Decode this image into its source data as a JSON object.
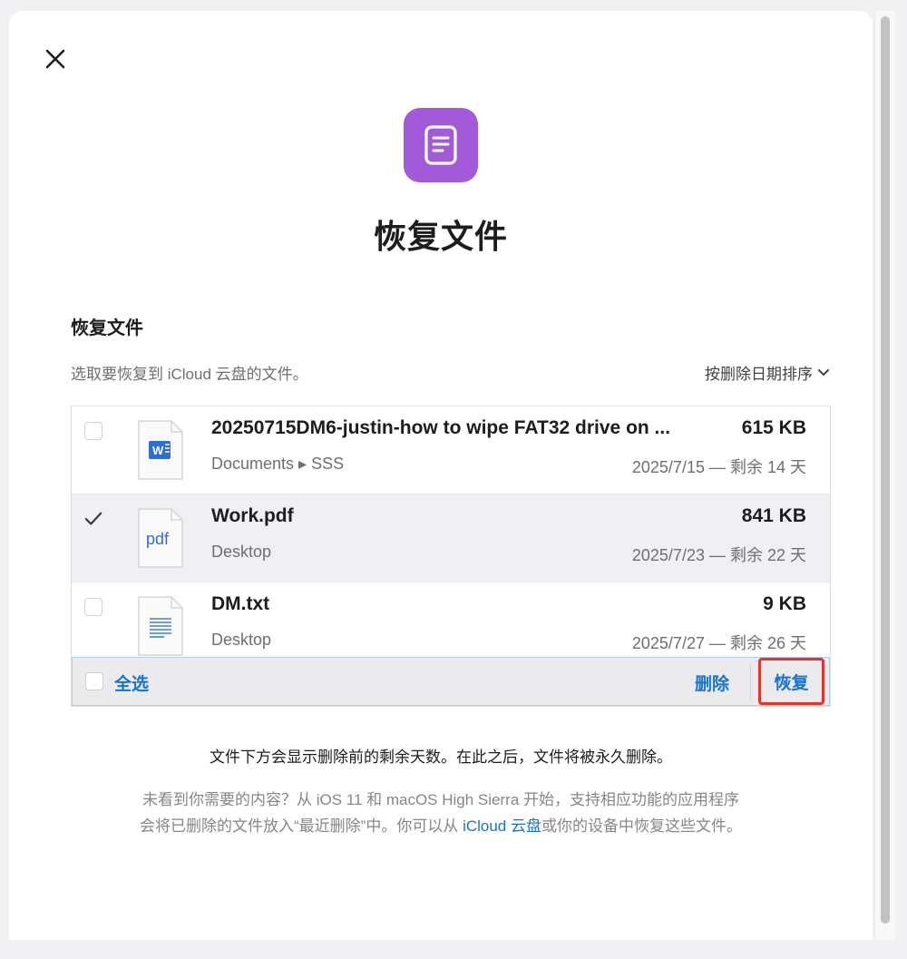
{
  "modal": {
    "title": "恢复文件",
    "section_heading": "恢复文件",
    "subtitle": "选取要恢复到 iCloud 云盘的文件。",
    "sort_label": "按删除日期排序"
  },
  "files": [
    {
      "name": "20250715DM6-justin-how to wipe FAT32 drive on ...",
      "size": "615 KB",
      "path": "Documents ▸ SSS",
      "meta": "2025/7/15 — 剩余 14 天",
      "checked": false,
      "icon": "word-doc-icon"
    },
    {
      "name": "Work.pdf",
      "size": "841 KB",
      "path": "Desktop",
      "meta": "2025/7/23 — 剩余 22 天",
      "checked": true,
      "icon": "pdf-icon",
      "icon_label": "pdf"
    },
    {
      "name": "DM.txt",
      "size": "9 KB",
      "path": "Desktop",
      "meta": "2025/7/27 — 剩余 26 天",
      "checked": false,
      "icon": "text-file-icon"
    }
  ],
  "footer": {
    "select_all": "全选",
    "delete": "删除",
    "restore": "恢复"
  },
  "info_text": "文件下方会显示删除前的剩余天数。在此之后，文件将被永久删除。",
  "help": {
    "part1": "未看到你需要的内容？从 iOS 11 和 macOS High Sierra 开始，支持相应功能的应用程序会将已删除的文件放入“最近删除”中。你可以从",
    "link": "iCloud 云盘",
    "part2": "或你的设备中恢复这些文件。"
  },
  "colors": {
    "accent": "#1673d4",
    "app_icon_bg": "#a35ad8",
    "highlight": "#e8322d"
  }
}
